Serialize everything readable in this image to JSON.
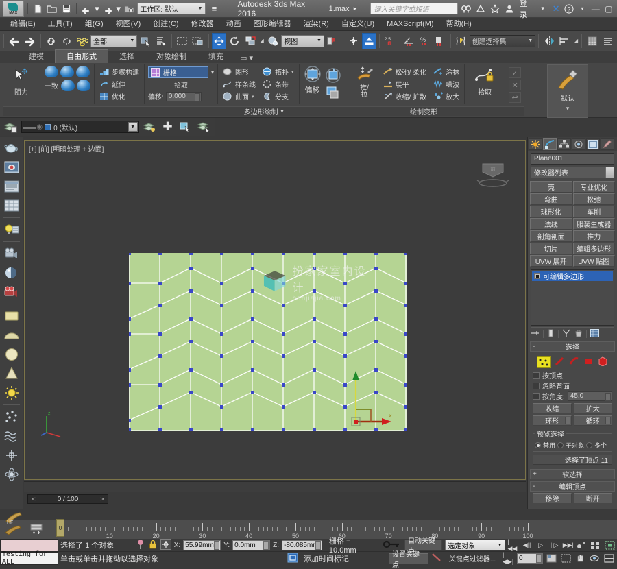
{
  "titlebar": {
    "app_title": "Autodesk 3ds Max 2016",
    "document": "1.max",
    "workspace_label": "工作区: 默认",
    "search_placeholder": "键入关键字或短语",
    "signin_label": "登录",
    "quick_icons": [
      "new-icon",
      "open-icon",
      "save-icon",
      "undo-icon",
      "redo-icon",
      "project-icon"
    ],
    "window_buttons": [
      "minimize",
      "maximize",
      "close"
    ]
  },
  "menubar": {
    "items": [
      {
        "label": "编辑(E)",
        "name": "menu-edit"
      },
      {
        "label": "工具(T)",
        "name": "menu-tools"
      },
      {
        "label": "组(G)",
        "name": "menu-group"
      },
      {
        "label": "视图(V)",
        "name": "menu-views"
      },
      {
        "label": "创建(C)",
        "name": "menu-create"
      },
      {
        "label": "修改器",
        "name": "menu-modifiers"
      },
      {
        "label": "动画",
        "name": "menu-animation"
      },
      {
        "label": "图形编辑器",
        "name": "menu-graph-editors"
      },
      {
        "label": "渲染(R)",
        "name": "menu-rendering"
      },
      {
        "label": "自定义(U)",
        "name": "menu-customize"
      },
      {
        "label": "MAXScript(M)",
        "name": "menu-maxscript"
      },
      {
        "label": "帮助(H)",
        "name": "menu-help"
      }
    ]
  },
  "maintoolbar": {
    "selection_filter": "全部",
    "reference_coord": "视图",
    "named_selection_set": "创建选择集",
    "angle_snap_value": "2.5"
  },
  "ribbon": {
    "tabs": [
      {
        "label": "建模",
        "active": false
      },
      {
        "label": "自由形式",
        "active": true
      },
      {
        "label": "选择",
        "active": false
      },
      {
        "label": "对象绘制",
        "active": false
      },
      {
        "label": "填充",
        "active": false
      }
    ],
    "group_drag": {
      "label": "阻力"
    },
    "group_conform": {
      "label": "一致"
    },
    "tools_build": [
      "步骤构建",
      "延伸",
      "优化"
    ],
    "pick_panel": {
      "target": "栅格",
      "pick_label": "拾取",
      "offset_label": "偏移:",
      "offset_value": "0.000"
    },
    "surface_items": [
      "图形",
      "拓扑",
      "样条线",
      "条带",
      "曲面",
      "分支"
    ],
    "poly_draw_footer": "多边形绘制",
    "offset_label": "偏移",
    "pushpull_label": "推/\n拉",
    "deform_items": [
      "松弛/ 柔化",
      "涂抹",
      "展平",
      "噪波",
      "收缩/ 扩散",
      "放大"
    ],
    "pick_deform": "拾取",
    "paint_default": "默认",
    "paint_deform_footer": "绘制变形"
  },
  "layerbar": {
    "layer_name": "0 (默认)"
  },
  "viewport": {
    "label": "[+] [前] [明暗处理 + 边面]",
    "object_color": "#b5d493",
    "wire_color": "#ffffff",
    "vertex_color": "#3a47c8",
    "watermark_line1": "扮家家室内设计",
    "watermark_line2": "banjiajia.com",
    "time_current": "0 / 100"
  },
  "command_panel": {
    "tabs": [
      "create-tab",
      "modify-tab",
      "hierarchy-tab",
      "motion-tab",
      "display-tab",
      "utilities-tab"
    ],
    "active_tab_index": 1,
    "object_name": "Plane001",
    "modifier_list_label": "修改器列表",
    "modifier_buttons": [
      "壳",
      "专业优化",
      "弯曲",
      "松弛",
      "球形化",
      "车削",
      "法线",
      "服装生成器",
      "剖角剖面",
      "推力",
      "切片",
      "编辑多边形",
      "UVW 展开",
      "UVW 贴图"
    ],
    "stack_entry": "可编辑多边形",
    "selection_rollout": {
      "title": "选择",
      "by_vertex": "按顶点",
      "ignore_backfacing": "忽略背面",
      "by_angle": "按角度:",
      "by_angle_value": "45.0",
      "shrink": "收缩",
      "grow": "扩大",
      "ring": "环形",
      "loop": "循环",
      "preview_title": "预览选择",
      "preview_options": [
        "禁用",
        "子对象",
        "多个"
      ],
      "status": "选择了顶点 11"
    },
    "soft_selection_title": "软选择",
    "edit_vertices_title": "编辑顶点",
    "edit_vertices_buttons": [
      "移除",
      "断开"
    ]
  },
  "statusbar": {
    "mini_listener_text": "Testing for ALL",
    "selection_status": "选择了 1 个对象",
    "coord_x_label": "X:",
    "coord_x": "55.99mm",
    "coord_y_label": "Y:",
    "coord_y": "0.0mm",
    "coord_z_label": "Z:",
    "coord_z": "-80.085mm",
    "grid_label": "栅格 = 10.0mm",
    "prompt": "单击或单击并拖动以选择对象",
    "add_time_tag": "添加时间标记",
    "auto_key": "自动关键点",
    "set_key": "设置关键点",
    "key_filters": "关键点过滤器...",
    "anim_mode": "选定对象",
    "frame_value": "0"
  },
  "timeline": {
    "ticks": [
      0,
      10,
      20,
      30,
      40,
      50,
      60,
      70,
      80,
      90,
      100
    ]
  }
}
